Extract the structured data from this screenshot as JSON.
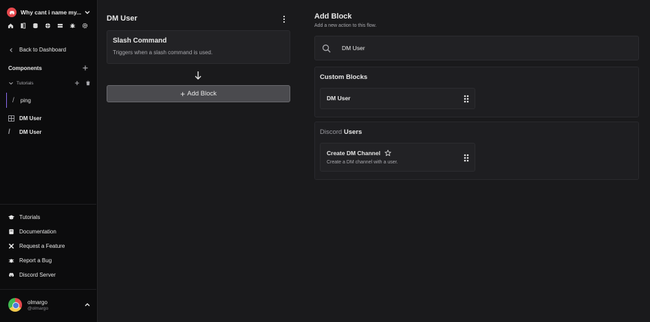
{
  "sidebar": {
    "workspace_name": "Why cant i name my...",
    "top_icons": [
      "home-icon",
      "bookmark-icon",
      "database-icon",
      "globe-icon",
      "server-icon",
      "bug-icon",
      "settings-icon"
    ],
    "back_label": "Back to Dashboard",
    "components_label": "Components",
    "folder_label": "Tutorials",
    "items": [
      {
        "label": "ping",
        "icon": "slash-command-icon"
      },
      {
        "label": "DM User",
        "icon": "grid-block-icon"
      },
      {
        "label": "DM User",
        "icon": "slash-command-icon"
      }
    ],
    "bottom_nav": [
      {
        "label": "Tutorials",
        "icon": "graduation-cap-icon"
      },
      {
        "label": "Documentation",
        "icon": "book-icon"
      },
      {
        "label": "Request a Feature",
        "icon": "tools-icon"
      },
      {
        "label": "Report a Bug",
        "icon": "bug-icon"
      },
      {
        "label": "Discord Server",
        "icon": "discord-icon"
      }
    ],
    "user": {
      "name": "olmargo",
      "handle": "@olmargo"
    }
  },
  "flow": {
    "title": "DM User",
    "trigger": {
      "title": "Slash Command",
      "description": "Triggers when a slash command is used."
    },
    "add_block_label": "Add Block"
  },
  "panel": {
    "title": "Add Block",
    "subtitle": "Add a new action to this flow.",
    "search_value": "DM User",
    "categories": [
      {
        "title": "Custom Blocks",
        "title_muted": "",
        "blocks": [
          {
            "name": "DM User",
            "description": ""
          }
        ]
      },
      {
        "title": "Users",
        "title_muted": "Discord",
        "blocks": [
          {
            "name": "Create DM Channel",
            "description": "Create a DM channel with a user."
          }
        ]
      }
    ]
  },
  "colors": {
    "accent": "#8b6cf0",
    "logo": "#e5484d",
    "background": "#1a1a1c",
    "sidebar": "#0c0c0d"
  }
}
